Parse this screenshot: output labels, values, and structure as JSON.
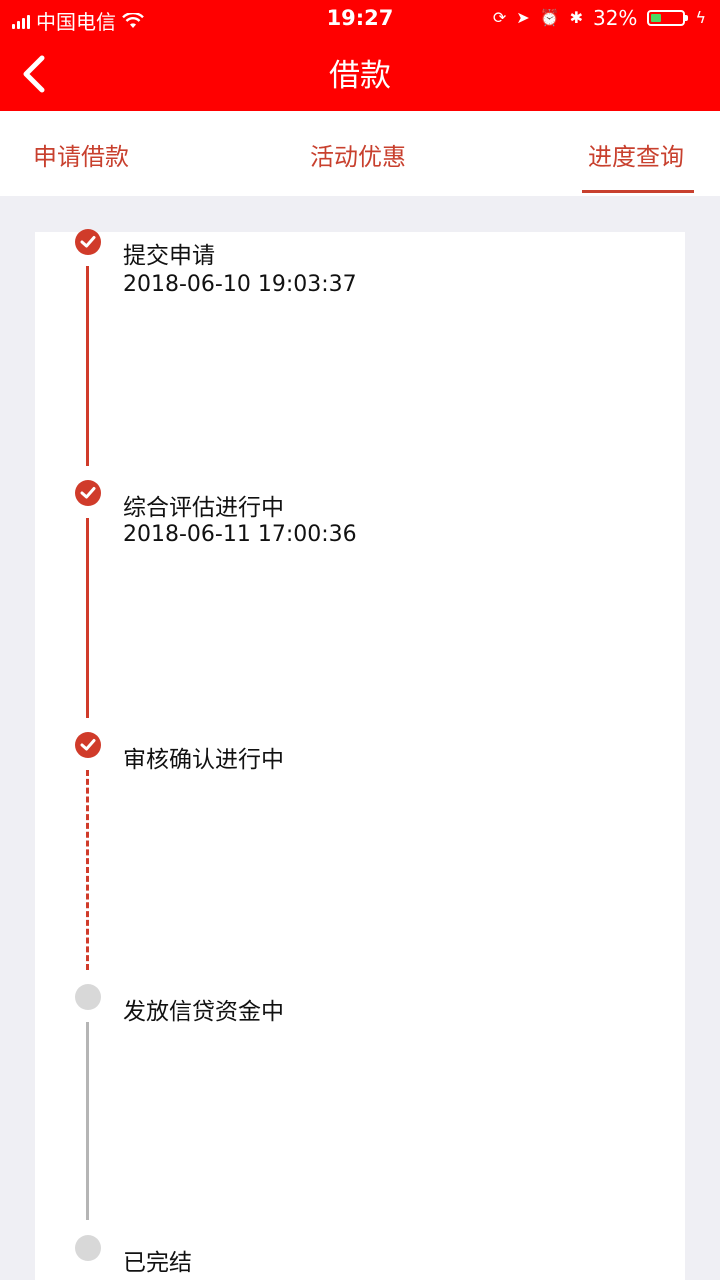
{
  "status_bar": {
    "carrier": "中国电信",
    "time": "19:27",
    "battery": "32%",
    "battery_level": 0.32
  },
  "nav": {
    "title": "借款"
  },
  "tabs": [
    {
      "label": "申请借款"
    },
    {
      "label": "活动优惠"
    },
    {
      "label": "进度查询",
      "active": true
    }
  ],
  "timeline": [
    {
      "title": "提交申请",
      "time": "2018-06-10 19:03:37",
      "status": "done"
    },
    {
      "title": "综合评估进行中",
      "time": "2018-06-11 17:00:36",
      "status": "done"
    },
    {
      "title": "审核确认进行中",
      "time": "",
      "status": "done"
    },
    {
      "title": "发放信贷资金中",
      "time": "",
      "status": "pending"
    },
    {
      "title": "已完结",
      "time": "",
      "status": "pending"
    }
  ],
  "colors": {
    "header": "#ff0000",
    "accent": "#c8402e",
    "done": "#d03b2a",
    "pending": "#d8d8d8"
  }
}
